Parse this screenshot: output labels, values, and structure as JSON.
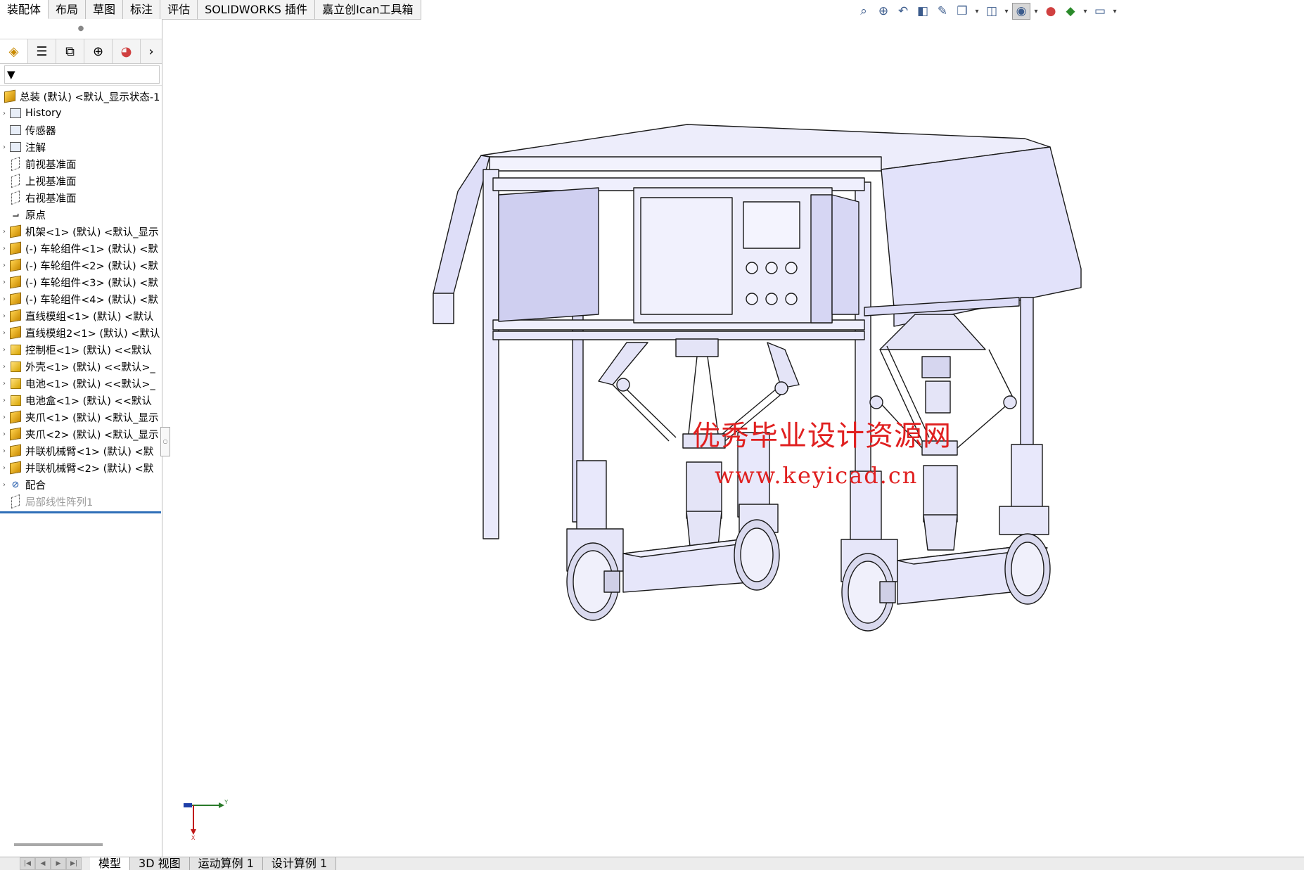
{
  "command_tabs": [
    "装配体",
    "布局",
    "草图",
    "标注",
    "评估",
    "SOLIDWORKS 插件",
    "嘉立创Ican工具箱"
  ],
  "active_command_tab": 0,
  "hud_icons": [
    "zoom-to-fit-icon",
    "zoom-area-icon",
    "previous-view-icon",
    "section-view-icon",
    "dynamic-annotation-icon",
    "view-orientation-icon",
    "display-style-icon",
    "hide-show-icon",
    "edit-appearance-icon",
    "apply-scene-icon",
    "view-settings-icon"
  ],
  "panel_tabs": [
    "featuremanager-tree-icon",
    "propertymanager-icon",
    "configurationmanager-icon",
    "dimxpert-icon",
    "display-manager-icon",
    "more-icon"
  ],
  "filter_symbol": "▼",
  "tree": [
    {
      "label": "总装 (默认) <默认_显示状态-1",
      "icon": "asm",
      "arrow": ""
    },
    {
      "label": "History",
      "icon": "folder",
      "arrow": "›"
    },
    {
      "label": "传感器",
      "icon": "folder",
      "arrow": ""
    },
    {
      "label": "注解",
      "icon": "folder",
      "arrow": "›"
    },
    {
      "label": "前视基准面",
      "icon": "plane",
      "arrow": ""
    },
    {
      "label": "上视基准面",
      "icon": "plane",
      "arrow": ""
    },
    {
      "label": "右视基准面",
      "icon": "plane",
      "arrow": ""
    },
    {
      "label": "原点",
      "icon": "origin",
      "arrow": ""
    },
    {
      "label": "机架<1> (默认) <默认_显示",
      "icon": "asm",
      "arrow": "›"
    },
    {
      "label": "(-) 车轮组件<1> (默认) <默",
      "icon": "asm",
      "arrow": "›"
    },
    {
      "label": "(-) 车轮组件<2> (默认) <默",
      "icon": "asm",
      "arrow": "›"
    },
    {
      "label": "(-) 车轮组件<3> (默认) <默",
      "icon": "asm",
      "arrow": "›"
    },
    {
      "label": "(-) 车轮组件<4> (默认) <默",
      "icon": "asm",
      "arrow": "›"
    },
    {
      "label": "直线模组<1> (默认) <默认",
      "icon": "asm",
      "arrow": "›"
    },
    {
      "label": "直线模组2<1> (默认) <默认",
      "icon": "asm",
      "arrow": "›"
    },
    {
      "label": "控制柜<1> (默认) <<默认",
      "icon": "part",
      "arrow": "›"
    },
    {
      "label": "外壳<1> (默认) <<默认>_",
      "icon": "part",
      "arrow": "›"
    },
    {
      "label": "电池<1> (默认) <<默认>_",
      "icon": "part",
      "arrow": "›"
    },
    {
      "label": "电池盒<1> (默认) <<默认",
      "icon": "part",
      "arrow": "›"
    },
    {
      "label": "夹爪<1> (默认) <默认_显示",
      "icon": "asm",
      "arrow": "›"
    },
    {
      "label": "夹爪<2> (默认) <默认_显示",
      "icon": "asm",
      "arrow": "›"
    },
    {
      "label": "并联机械臂<1> (默认) <默",
      "icon": "asm",
      "arrow": "›"
    },
    {
      "label": "并联机械臂<2> (默认) <默",
      "icon": "asm",
      "arrow": "›"
    },
    {
      "label": "配合",
      "icon": "mate",
      "arrow": "›"
    },
    {
      "label": "局部线性阵列1",
      "icon": "plane",
      "arrow": "",
      "grey": true
    }
  ],
  "watermark": {
    "line1": "优秀毕业设计资源网",
    "line2": "www.keyicad.cn"
  },
  "triad": {
    "y": "Y",
    "x": "X"
  },
  "bottom_tabs": [
    "模型",
    "3D 视图",
    "运动算例 1",
    "设计算例 1"
  ],
  "active_bottom_tab": 0,
  "colors": {
    "model_face": "#e6e6fb",
    "model_dark": "#c8c8f0",
    "model_line": "#1a1a1a",
    "accent": "#2f6fb8"
  }
}
